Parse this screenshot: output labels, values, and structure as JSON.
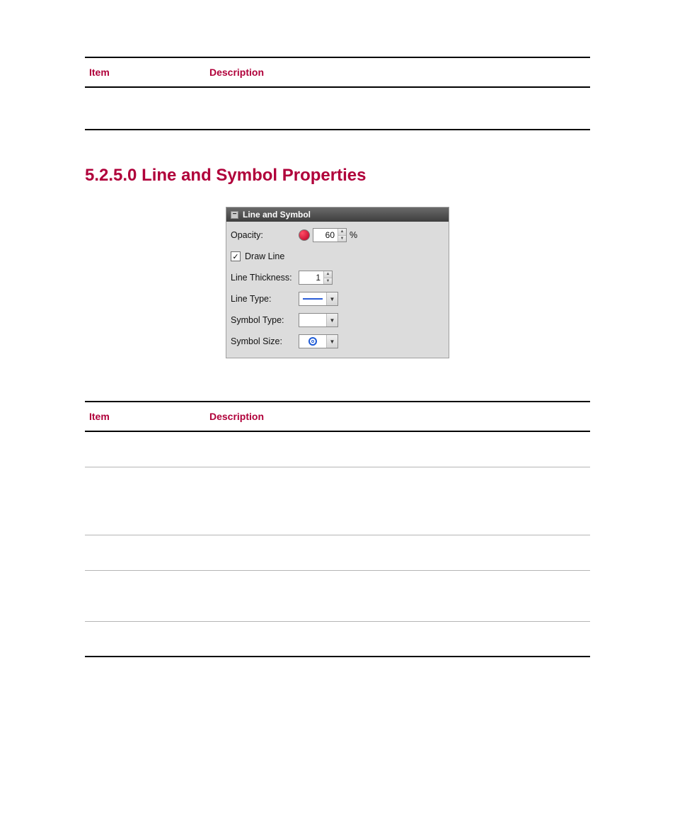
{
  "top_table": {
    "headers": {
      "item": "Item",
      "description": "Description"
    }
  },
  "section_heading": "5.2.5.0 Line and Symbol Properties",
  "panel": {
    "title": "Line and Symbol",
    "collapse_glyph": "−",
    "rows": {
      "opacity_label": "Opacity:",
      "opacity_value": "60",
      "opacity_unit": "%",
      "draw_line_label": "Draw Line",
      "draw_line_checked_glyph": "✓",
      "line_thickness_label": "Line Thickness:",
      "line_thickness_value": "1",
      "line_type_label": "Line Type:",
      "symbol_type_label": "Symbol Type:",
      "symbol_size_label": "Symbol Size:",
      "dropdown_arrow": "▼",
      "spinner_up": "▲",
      "spinner_down": "▼"
    }
  },
  "big_table": {
    "headers": {
      "item": "Item",
      "description": "Description"
    }
  }
}
